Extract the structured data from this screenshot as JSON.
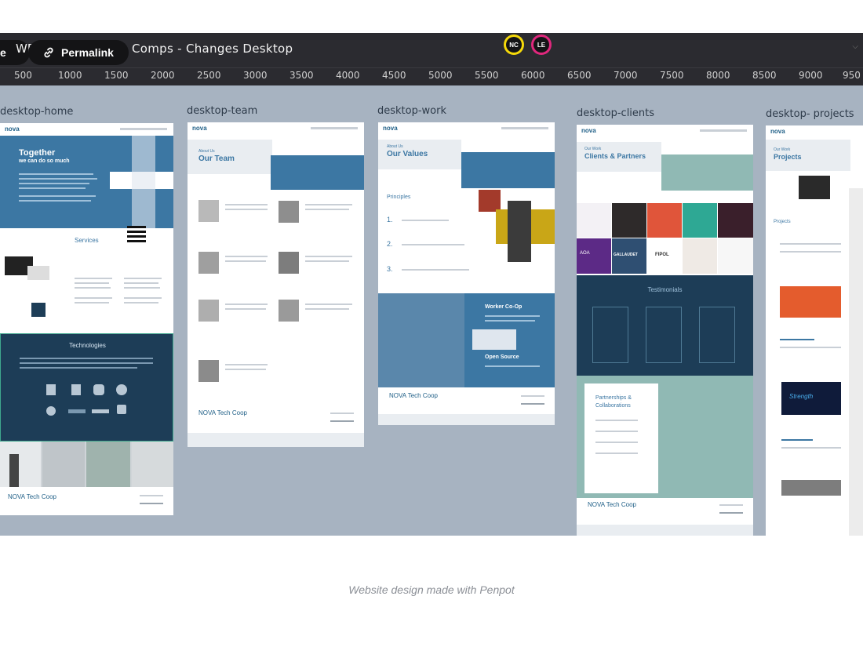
{
  "header": {
    "title_prefix": "WD",
    "title": "Comps - Changes Desktop",
    "share_label": "e",
    "permalink_label": "Permalink",
    "avatars": [
      "NC",
      "LE"
    ]
  },
  "ruler": [
    "500",
    "1000",
    "1500",
    "2000",
    "2500",
    "3000",
    "3500",
    "4000",
    "4500",
    "5000",
    "5500",
    "6000",
    "6500",
    "7000",
    "7500",
    "8000",
    "8500",
    "9000",
    "950"
  ],
  "boards": [
    {
      "label": "desktop-home",
      "logo": "nova"
    },
    {
      "label": "desktop-team",
      "logo": "nova"
    },
    {
      "label": "desktop-work",
      "logo": "nova"
    },
    {
      "label": "desktop-clients",
      "logo": "nova"
    },
    {
      "label": "desktop- projects",
      "logo": "nova"
    }
  ],
  "home": {
    "hero_title": "Together",
    "hero_subtitle": "we can do so much",
    "services": "Services",
    "technologies": "Technologies",
    "footer": "NOVA Tech Coop"
  },
  "team": {
    "title_small": "About Us",
    "title": "Our Team",
    "footer": "NOVA Tech Coop"
  },
  "work": {
    "title_small": "About Us",
    "title": "Our Values",
    "principles": "Principles",
    "numbers": [
      "1.",
      "2.",
      "3."
    ],
    "coop": "Worker Co-Op",
    "open": "Open Source",
    "footer": "NOVA Tech Coop"
  },
  "clients": {
    "title_small": "Our Work",
    "title": "Clients & Partners",
    "testimonials": "Testimonials",
    "partnerships": "Partnerships & Collaborations",
    "footer": "NOVA Tech Coop",
    "logos": [
      "AOA",
      "GALLAUDET",
      "FIPOL"
    ]
  },
  "projects": {
    "title_small": "Our Work",
    "title": "Projects",
    "projects_label": "Projects",
    "strength": "Strength"
  },
  "caption": "Website design made with Penpot",
  "colors": {
    "canvas": "#a7b3c1",
    "toolbar": "#2b2b30",
    "avatar_nc": "#f5d90a",
    "avatar_le": "#e0287d",
    "brand_blue": "#3c77a3",
    "brand_dark": "#1d3d57"
  }
}
